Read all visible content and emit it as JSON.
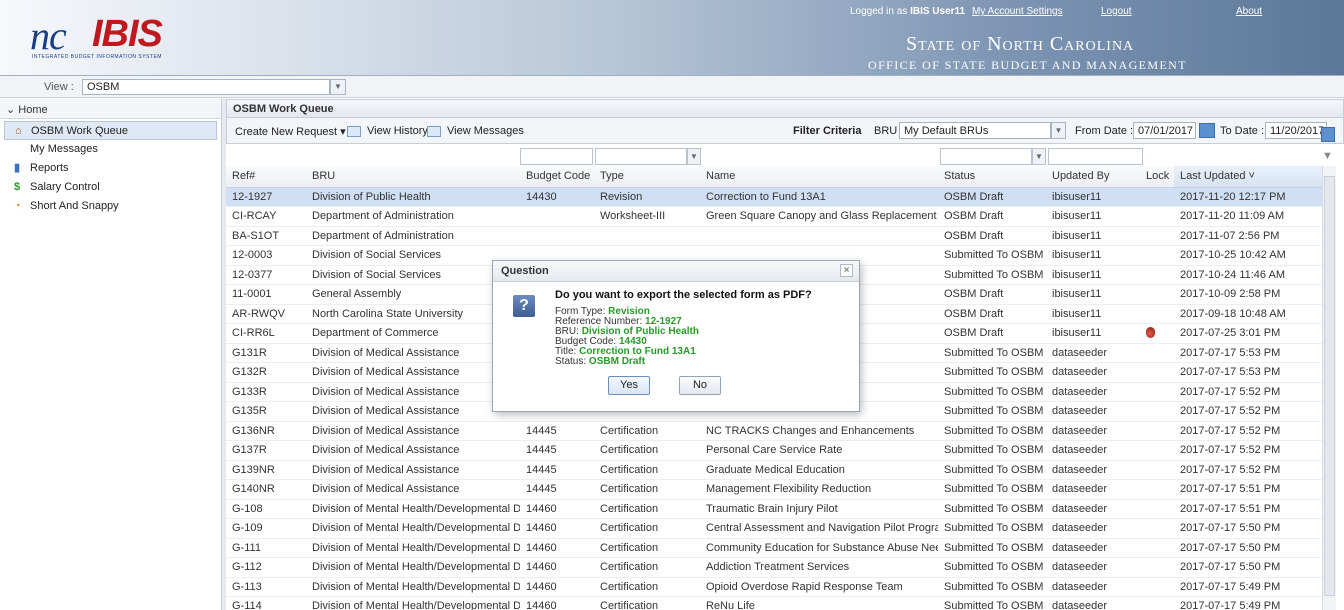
{
  "header": {
    "logo_nc": "nc",
    "logo_ibis": "IBIS",
    "logo_sub": "INTEGRATED BUDGET INFORMATION SYSTEM",
    "logged_in_prefix": "Logged in as",
    "user": "IBIS User11",
    "account_settings": "My Account Settings",
    "logout": "Logout",
    "about": "About",
    "state_title": "State of North Carolina",
    "office_title": "OFFICE OF STATE BUDGET AND MANAGEMENT"
  },
  "viewbar": {
    "label": "View :",
    "value": "OSBM"
  },
  "sidebar": {
    "home": "Home",
    "items": [
      {
        "label": "OSBM Work Queue",
        "icon": "house-icon",
        "active": true
      },
      {
        "label": "My Messages",
        "icon": "none"
      },
      {
        "label": "Reports",
        "icon": "bar-chart-icon"
      },
      {
        "label": "Salary Control",
        "icon": "dollar-icon"
      },
      {
        "label": "Short And Snappy",
        "icon": "clock-icon"
      }
    ]
  },
  "panel": {
    "title": "OSBM Work Queue"
  },
  "toolbar": {
    "create_new": "Create New Request",
    "view_history": "View History",
    "view_messages": "View Messages",
    "filter_criteria": "Filter Criteria",
    "bru_label": "BRU :",
    "bru_value": "My Default BRUs",
    "from_label": "From Date :",
    "from_value": "07/01/2017",
    "to_label": "To Date :",
    "to_value": "11/20/2017"
  },
  "table": {
    "columns": [
      "Ref#",
      "BRU",
      "Budget Code",
      "Type",
      "Name",
      "Status",
      "Updated By",
      "Lock",
      "Last Updated"
    ],
    "sort_indicator": "˅",
    "rows": [
      [
        "12-1927",
        "Division of Public Health",
        "14430",
        "Revision",
        "Correction to Fund 13A1",
        "OSBM Draft",
        "ibisuser11",
        "",
        "2017-11-20 12:17 PM"
      ],
      [
        "CI-RCAY",
        "Department of Administration",
        "",
        "Worksheet-III",
        "Green Square Canopy and Glass Replacement",
        "OSBM Draft",
        "ibisuser11",
        "",
        "2017-11-20 11:09 AM"
      ],
      [
        "BA-S1OT",
        "Department of Administration",
        "",
        "",
        "",
        "OSBM Draft",
        "ibisuser11",
        "",
        "2017-11-07 2:56 PM"
      ],
      [
        "12-0003",
        "Division of Social Services",
        "",
        "",
        "",
        "Submitted To OSBM",
        "ibisuser11",
        "",
        "2017-10-25 10:42 AM"
      ],
      [
        "12-0377",
        "Division of Social Services",
        "",
        "",
        "",
        "Submitted To OSBM",
        "ibisuser11",
        "",
        "2017-10-24 11:46 AM"
      ],
      [
        "11-0001",
        "General Assembly",
        "",
        "",
        "",
        "OSBM Draft",
        "ibisuser11",
        "",
        "2017-10-09 2:58 PM"
      ],
      [
        "AR-RWQV",
        "North Carolina State University",
        "",
        "",
        "",
        "OSBM Draft",
        "ibisuser11",
        "",
        "2017-09-18 10:48 AM"
      ],
      [
        "CI-RR6L",
        "Department of Commerce",
        "",
        "",
        "",
        "OSBM Draft",
        "ibisuser11",
        "lock",
        "2017-07-25 3:01 PM"
      ],
      [
        "G131R",
        "Division of Medical Assistance",
        "",
        "",
        "",
        "Submitted To OSBM",
        "dataseeder",
        "",
        "2017-07-17 5:53 PM"
      ],
      [
        "G132R",
        "Division of Medical Assistance",
        "",
        "",
        "",
        "Submitted To OSBM",
        "dataseeder",
        "",
        "2017-07-17 5:53 PM"
      ],
      [
        "G133R",
        "Division of Medical Assistance",
        "",
        "",
        "",
        "Submitted To OSBM",
        "dataseeder",
        "",
        "2017-07-17 5:52 PM"
      ],
      [
        "G135R",
        "Division of Medical Assistance",
        "",
        "",
        "",
        "Submitted To OSBM",
        "dataseeder",
        "",
        "2017-07-17 5:52 PM"
      ],
      [
        "G136NR",
        "Division of Medical Assistance",
        "14445",
        "Certification",
        "NC TRACKS Changes and Enhancements",
        "Submitted To OSBM",
        "dataseeder",
        "",
        "2017-07-17 5:52 PM"
      ],
      [
        "G137R",
        "Division of Medical Assistance",
        "14445",
        "Certification",
        "Personal Care Service Rate",
        "Submitted To OSBM",
        "dataseeder",
        "",
        "2017-07-17 5:52 PM"
      ],
      [
        "G139NR",
        "Division of Medical Assistance",
        "14445",
        "Certification",
        "Graduate Medical Education",
        "Submitted To OSBM",
        "dataseeder",
        "",
        "2017-07-17 5:52 PM"
      ],
      [
        "G140NR",
        "Division of Medical Assistance",
        "14445",
        "Certification",
        "Management Flexibility Reduction",
        "Submitted To OSBM",
        "dataseeder",
        "",
        "2017-07-17 5:51 PM"
      ],
      [
        "G-108",
        "Division of Mental Health/Developmental Disabili...",
        "14460",
        "Certification",
        "Traumatic Brain Injury Pilot",
        "Submitted To OSBM",
        "dataseeder",
        "",
        "2017-07-17 5:51 PM"
      ],
      [
        "G-109",
        "Division of Mental Health/Developmental Disabili...",
        "14460",
        "Certification",
        "Central Assessment and Navigation Pilot Program",
        "Submitted To OSBM",
        "dataseeder",
        "",
        "2017-07-17 5:50 PM"
      ],
      [
        "G-111",
        "Division of Mental Health/Developmental Disabili...",
        "14460",
        "Certification",
        "Community Education for Substance Abuse Needs",
        "Submitted To OSBM",
        "dataseeder",
        "",
        "2017-07-17 5:50 PM"
      ],
      [
        "G-112",
        "Division of Mental Health/Developmental Disabili...",
        "14460",
        "Certification",
        "Addiction Treatment Services",
        "Submitted To OSBM",
        "dataseeder",
        "",
        "2017-07-17 5:50 PM"
      ],
      [
        "G-113",
        "Division of Mental Health/Developmental Disabili...",
        "14460",
        "Certification",
        "Opioid Overdose Rapid Response Team",
        "Submitted To OSBM",
        "dataseeder",
        "",
        "2017-07-17 5:49 PM"
      ],
      [
        "G-114",
        "Division of Mental Health/Developmental Disabili...",
        "14460",
        "Certification",
        "ReNu Life",
        "Submitted To OSBM",
        "dataseeder",
        "",
        "2017-07-17 5:49 PM"
      ]
    ]
  },
  "dialog": {
    "title": "Question",
    "question": "Do you want to export the selected form as PDF?",
    "form_type_label": "Form Type:",
    "form_type": "Revision",
    "ref_label": "Reference Number:",
    "ref": "12-1927",
    "bru_label": "BRU:",
    "bru": "Division of Public Health",
    "budget_label": "Budget Code:",
    "budget": "14430",
    "title_label": "Title:",
    "title_value": "Correction to Fund 13A1",
    "status_label": "Status:",
    "status": "OSBM Draft",
    "yes": "Yes",
    "no": "No"
  },
  "colors": {
    "accent": "#1b3d86",
    "logo_red": "#c0181f",
    "info_green": "#2a9a2a",
    "selected_row": "#cfe0f4",
    "arrow": "#d9342b"
  }
}
